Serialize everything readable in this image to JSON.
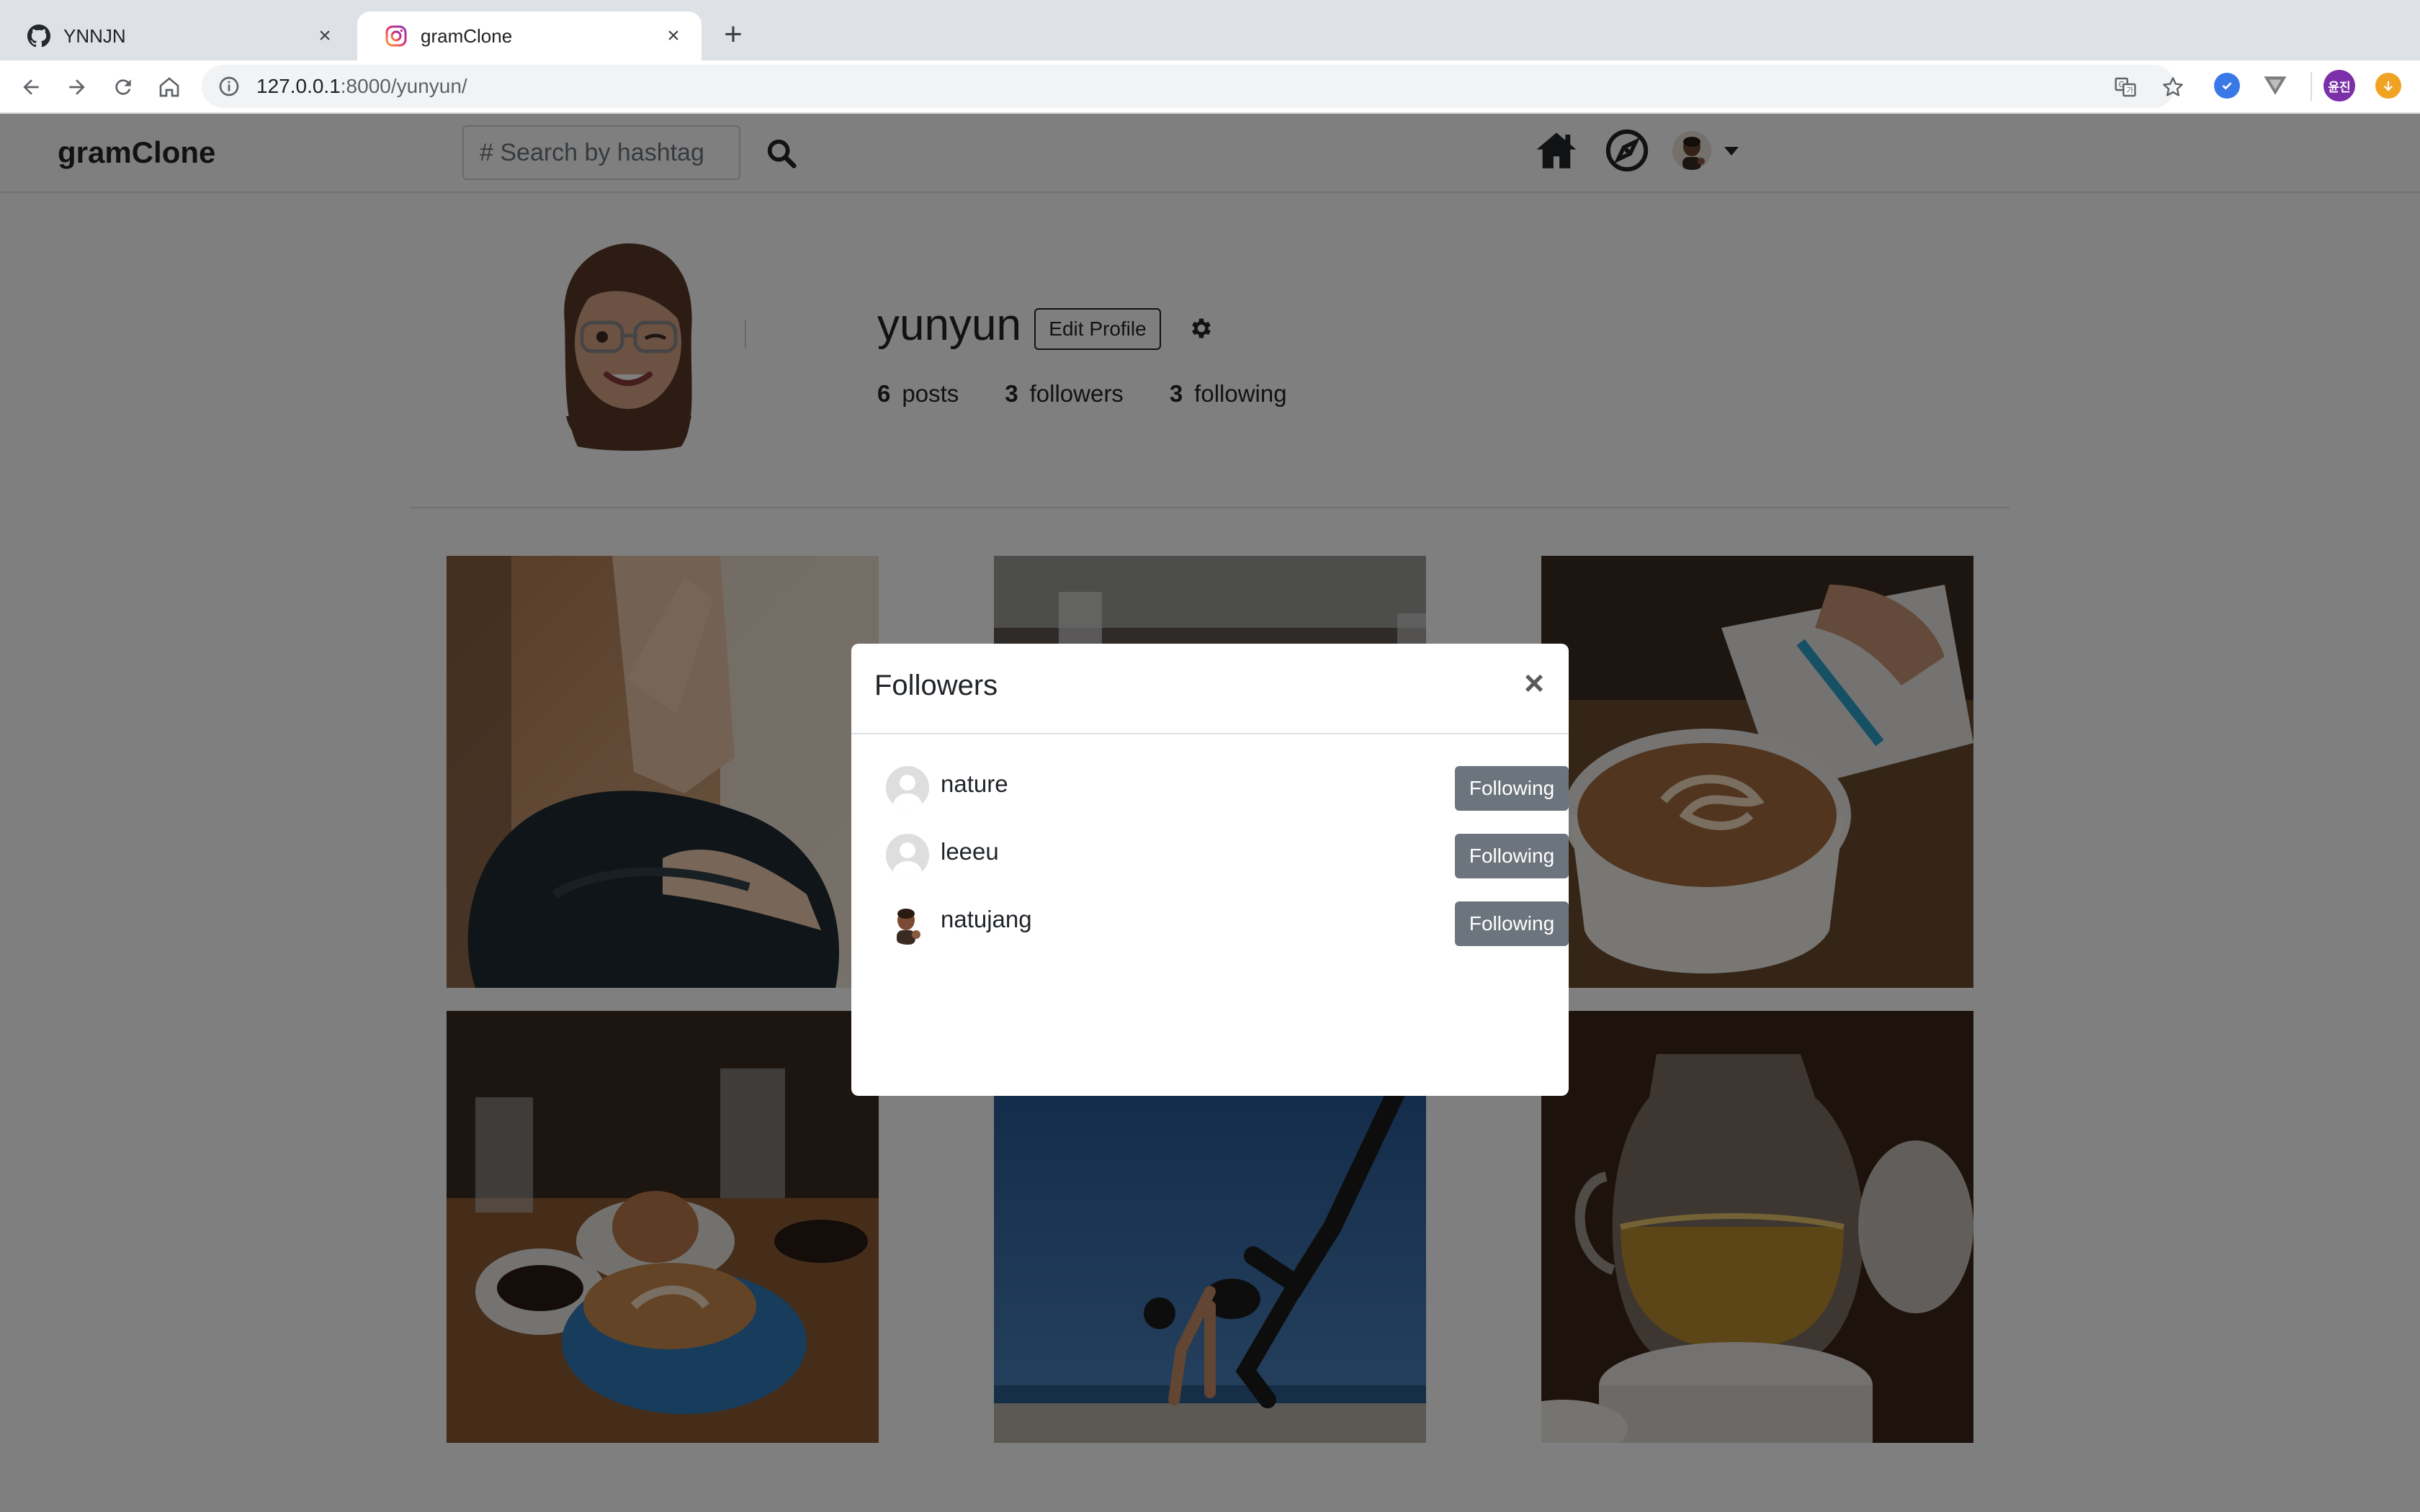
{
  "browser": {
    "tabs": [
      {
        "title": "YNNJN",
        "icon": "github-icon",
        "active": false
      },
      {
        "title": "gramClone",
        "icon": "instagram-icon",
        "active": true
      }
    ],
    "url_host": "127.0.0.1",
    "url_rest": ":8000/yunyun/",
    "extension_badge": "윤진"
  },
  "navbar": {
    "brand": "gramClone",
    "search_placeholder": "# Search by hashtag"
  },
  "profile": {
    "username": "yunyun",
    "edit_label": "Edit Profile",
    "stats": [
      {
        "count": "6",
        "label": "posts"
      },
      {
        "count": "3",
        "label": "followers"
      },
      {
        "count": "3",
        "label": "following"
      }
    ]
  },
  "posts": [
    {
      "subject": "yoga-meditation"
    },
    {
      "subject": "coffee-table"
    },
    {
      "subject": "latte-notebook"
    },
    {
      "subject": "coffee-donut"
    },
    {
      "subject": "yoga-pose-beach"
    },
    {
      "subject": "tea-pot"
    }
  ],
  "modal": {
    "title": "Followers",
    "close_label": "×",
    "followers": [
      {
        "name": "nature",
        "button": "Following",
        "avatar": "default"
      },
      {
        "name": "leeeu",
        "button": "Following",
        "avatar": "default"
      },
      {
        "name": "natujang",
        "button": "Following",
        "avatar": "emoji"
      }
    ]
  },
  "colors": {
    "tabstrip": "#dee1e6",
    "button_secondary": "#6c757d",
    "backdrop": "rgba(0,0,0,0.5)",
    "extension_purple": "#7b2fa8",
    "extension_orange": "#f0a322",
    "extension_blue": "#3b78e7"
  }
}
